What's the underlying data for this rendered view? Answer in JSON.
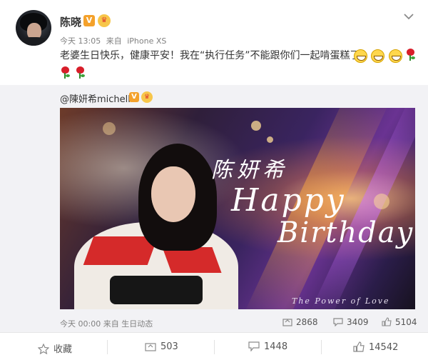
{
  "post": {
    "username": "陈晓",
    "verified_badge": "V",
    "meta": {
      "time": "今天 13:05",
      "source_prefix": "来自",
      "source": "iPhone XS"
    },
    "text": "老婆生日快乐，健康平安！我在“执行任务”不能跟你们一起啃蛋糕了",
    "emoji_icons": [
      "grin-icon",
      "grin-icon",
      "grin-icon",
      "rose-icon"
    ],
    "rose_icons": [
      "rose-icon",
      "rose-icon"
    ]
  },
  "repost": {
    "author": "@陳妍希michelle",
    "verified_badge": "V",
    "image": {
      "signature": "陈妍希",
      "happy": "Happy",
      "birthday": "Birthday",
      "tagline": "The Power of Love"
    },
    "meta": {
      "time": "今天 00:00",
      "source_prefix": "来自",
      "source": "生日动态"
    },
    "stats": {
      "reposts": "2868",
      "comments": "3409",
      "likes": "5104"
    }
  },
  "actions": {
    "favorite": "收藏",
    "repost": "503",
    "comment": "1448",
    "like": "14542"
  },
  "colors": {
    "accent": "#ff8200",
    "vip": "#f4a12b",
    "muted": "#808080",
    "repost_bg": "#f2f2f5"
  }
}
